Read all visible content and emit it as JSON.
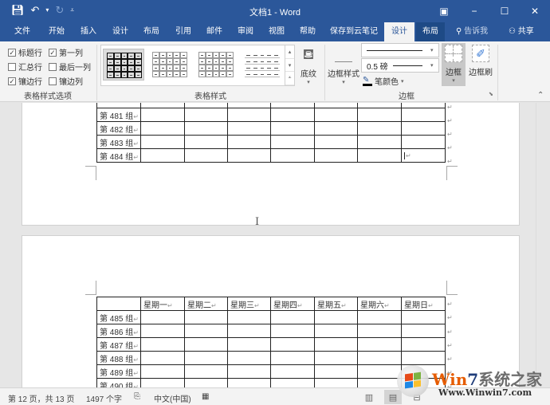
{
  "window": {
    "title": "文档1 - Word",
    "qat": {
      "save_icon": "save-icon",
      "undo_icon": "undo-icon",
      "redo_icon": "redo-icon",
      "customize_icon": "customize-qat-icon"
    },
    "controls": {
      "ribbon_display": "▣",
      "minimize": "−",
      "maximize": "☐",
      "close": "✕"
    }
  },
  "tabs": [
    {
      "label": "文件"
    },
    {
      "label": "开始"
    },
    {
      "label": "插入"
    },
    {
      "label": "设计"
    },
    {
      "label": "布局"
    },
    {
      "label": "引用"
    },
    {
      "label": "邮件"
    },
    {
      "label": "审阅"
    },
    {
      "label": "视图"
    },
    {
      "label": "帮助"
    },
    {
      "label": "保存到云笔记"
    },
    {
      "label": "设计",
      "active": true,
      "context": true
    },
    {
      "label": "布局",
      "context": true
    }
  ],
  "tell_me": "告诉我",
  "share": "共享",
  "ribbon": {
    "options_group": {
      "label": "表格样式选项",
      "checkboxes": [
        {
          "label": "标题行",
          "checked": true
        },
        {
          "label": "第一列",
          "checked": true
        },
        {
          "label": "汇总行",
          "checked": false
        },
        {
          "label": "最后一列",
          "checked": false
        },
        {
          "label": "镶边行",
          "checked": true
        },
        {
          "label": "镶边列",
          "checked": false
        }
      ]
    },
    "styles_group": {
      "label": "表格样式",
      "shading_label": "底纹"
    },
    "borders_group": {
      "label": "边框",
      "border_styles_label": "边框样式",
      "line_weight": "0.5 磅",
      "pen_color_label": "笔颜色",
      "borders_label": "边框",
      "border_painter_label": "边框刷"
    }
  },
  "document": {
    "table1": {
      "rows": [
        "第 481 组",
        "第 482 组",
        "第 483 组",
        "第 484 组"
      ]
    },
    "table2": {
      "headers": [
        "",
        "星期一",
        "星期二",
        "星期三",
        "星期四",
        "星期五",
        "星期六",
        "星期日"
      ],
      "rows": [
        "第 485 组",
        "第 486 组",
        "第 487 组",
        "第 488 组",
        "第 489 组",
        "第 490 组"
      ]
    },
    "pilcrow": "↵"
  },
  "status": {
    "page": "第 12 页，共 13 页",
    "words": "1497 个字",
    "language": "中文(中国)"
  },
  "watermark": {
    "brand_w": "Win",
    "brand_7": "7",
    "brand_cn": "系统之家",
    "url": "Www.Winwin7.com"
  }
}
